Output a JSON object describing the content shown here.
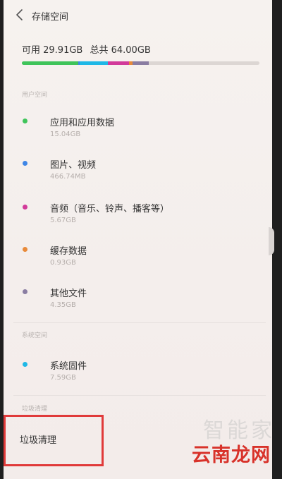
{
  "header": {
    "title": "存储空间",
    "back_icon": "chevron-left-icon"
  },
  "summary": {
    "available": "可用 29.91GB",
    "total": "总共 64.00GB"
  },
  "usage_bar": {
    "segments": [
      {
        "color": "#3fc45a",
        "fraction": 0.236
      },
      {
        "color": "#3e86e6",
        "fraction": 0.007
      },
      {
        "color": "#1fb8e6",
        "fraction": 0.118
      },
      {
        "color": "#d23a9a",
        "fraction": 0.089
      },
      {
        "color": "#e88a3a",
        "fraction": 0.015
      },
      {
        "color": "#8a7da2",
        "fraction": 0.068
      }
    ],
    "track_color": "#dcd6d3"
  },
  "sections": {
    "user_space": "用户空间",
    "system_space": "系统空间",
    "junk_cleanup": "垃圾清理"
  },
  "items": [
    {
      "name": "应用和应用数据",
      "size": "15.04GB",
      "color": "#3fc45a"
    },
    {
      "name": "图片、视频",
      "size": "466.74MB",
      "color": "#3e86e6"
    },
    {
      "name": "音频（音乐、铃声、播客等）",
      "size": "5.67GB",
      "color": "#d23a9a"
    },
    {
      "name": "缓存数据",
      "size": "0.93GB",
      "color": "#e88a3a"
    },
    {
      "name": "其他文件",
      "size": "4.35GB",
      "color": "#8a7da2"
    }
  ],
  "system_item": {
    "name": "系统固件",
    "size": "7.59GB",
    "color": "#1fb8e6"
  },
  "cleanup": {
    "label": "垃圾清理",
    "highlight_color": "#e03a3a"
  },
  "watermark": {
    "top": "智能家",
    "bottom": "云南龙网"
  }
}
